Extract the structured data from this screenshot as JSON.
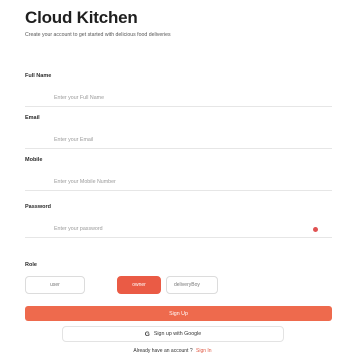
{
  "app": {
    "title": "Cloud Kitchen",
    "subtitle": "Create your account to get started with delicious food deliveries"
  },
  "form": {
    "full_name": {
      "label": "Full Name",
      "placeholder": "Enter your Full Name"
    },
    "email": {
      "label": "Email",
      "placeholder": "Enter your Email"
    },
    "mobile": {
      "label": "Mobile",
      "placeholder": "Enter your Mobile Number"
    },
    "password": {
      "label": "Password",
      "placeholder": "Enter your password"
    },
    "role": {
      "label": "Role",
      "options": [
        "user",
        "owner",
        "deliveryBoy"
      ],
      "selected": "owner"
    }
  },
  "actions": {
    "signup_label": "Sign Up",
    "google_label": "Sign up with Google"
  },
  "footer": {
    "prompt": "Already have an account ?",
    "link": "Sign In"
  },
  "colors": {
    "accent": "#ee6a4d",
    "selected_role": "#ea5b45"
  },
  "icons": {
    "google": "google-icon",
    "password_toggle": "eye-icon"
  }
}
